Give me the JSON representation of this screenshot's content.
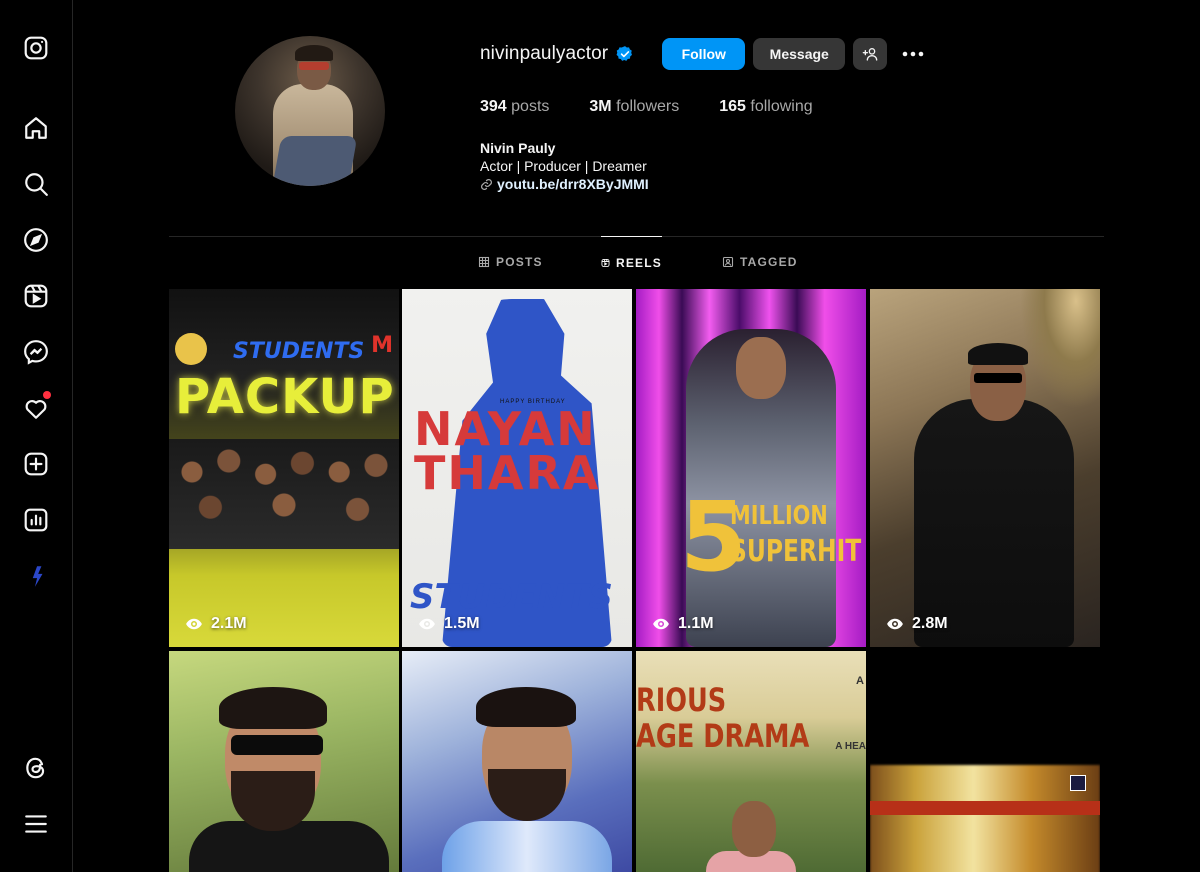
{
  "sidebar": {
    "items": [
      {
        "name": "instagram-logo-icon"
      },
      {
        "name": "home-icon"
      },
      {
        "name": "search-icon"
      },
      {
        "name": "explore-icon"
      },
      {
        "name": "reels-icon"
      },
      {
        "name": "messenger-icon"
      },
      {
        "name": "notifications-heart-icon"
      },
      {
        "name": "create-icon"
      },
      {
        "name": "dashboard-icon"
      },
      {
        "name": "profile-icon"
      },
      {
        "name": "threads-icon"
      },
      {
        "name": "menu-icon"
      }
    ]
  },
  "profile": {
    "username": "nivinpaulyactor",
    "verified": true,
    "follow_label": "Follow",
    "message_label": "Message",
    "stats": {
      "posts_count": "394",
      "posts_label": "posts",
      "followers_count": "3M",
      "followers_label": "followers",
      "following_count": "165",
      "following_label": "following"
    },
    "full_name": "Nivin Pauly",
    "bio": "Actor | Producer | Dreamer",
    "link": "youtu.be/drr8XByJMMI"
  },
  "tabs": [
    {
      "label": "POSTS",
      "active": false
    },
    {
      "label": "REELS",
      "active": true
    },
    {
      "label": "TAGGED",
      "active": false
    }
  ],
  "reels": [
    {
      "views": "2.1M",
      "texts": [
        "PACKUP",
        "STUDENTS",
        "M"
      ]
    },
    {
      "views": "1.5M",
      "texts": [
        "NAYAN",
        "THARA",
        "HAPPY BIRTHDAY",
        "STUDENTS"
      ]
    },
    {
      "views": "1.1M",
      "texts": [
        "5",
        "MILLION",
        "SUPERHIT"
      ]
    },
    {
      "views": "2.8M",
      "texts": []
    },
    {
      "views": "",
      "texts": []
    },
    {
      "views": "",
      "texts": []
    },
    {
      "views": "",
      "texts": [
        "RIOUS",
        "AGE DRAMA",
        "A",
        "A HEA"
      ]
    },
    {
      "views": "",
      "texts": []
    }
  ],
  "colors": {
    "background": "#000000",
    "follow_button": "#0095f6",
    "secondary_button": "#363636",
    "verified_badge": "#0095f6",
    "notification_dot": "#ff3040"
  }
}
